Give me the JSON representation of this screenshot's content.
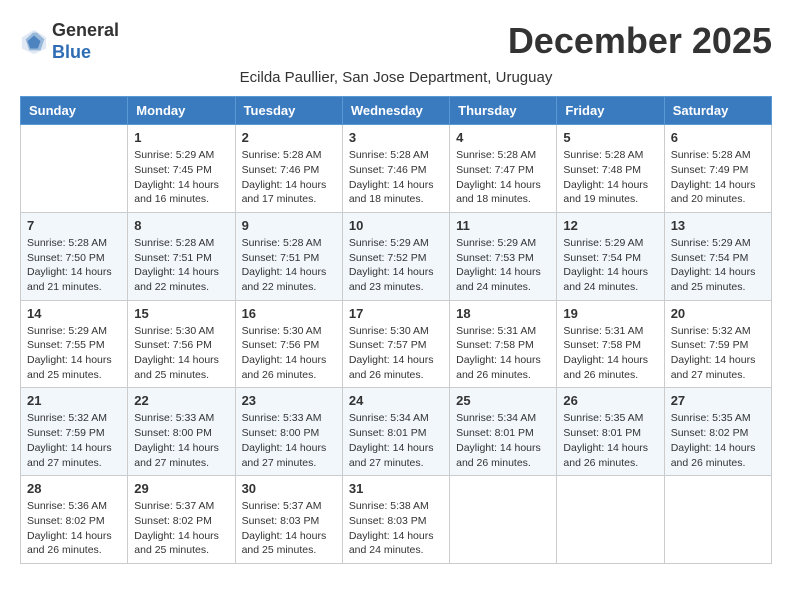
{
  "header": {
    "logo_line1": "General",
    "logo_line2": "Blue",
    "month_title": "December 2025",
    "subtitle": "Ecilda Paullier, San Jose Department, Uruguay"
  },
  "weekdays": [
    "Sunday",
    "Monday",
    "Tuesday",
    "Wednesday",
    "Thursday",
    "Friday",
    "Saturday"
  ],
  "weeks": [
    [
      {
        "day": "",
        "info": ""
      },
      {
        "day": "1",
        "info": "Sunrise: 5:29 AM\nSunset: 7:45 PM\nDaylight: 14 hours\nand 16 minutes."
      },
      {
        "day": "2",
        "info": "Sunrise: 5:28 AM\nSunset: 7:46 PM\nDaylight: 14 hours\nand 17 minutes."
      },
      {
        "day": "3",
        "info": "Sunrise: 5:28 AM\nSunset: 7:46 PM\nDaylight: 14 hours\nand 18 minutes."
      },
      {
        "day": "4",
        "info": "Sunrise: 5:28 AM\nSunset: 7:47 PM\nDaylight: 14 hours\nand 18 minutes."
      },
      {
        "day": "5",
        "info": "Sunrise: 5:28 AM\nSunset: 7:48 PM\nDaylight: 14 hours\nand 19 minutes."
      },
      {
        "day": "6",
        "info": "Sunrise: 5:28 AM\nSunset: 7:49 PM\nDaylight: 14 hours\nand 20 minutes."
      }
    ],
    [
      {
        "day": "7",
        "info": "Sunrise: 5:28 AM\nSunset: 7:50 PM\nDaylight: 14 hours\nand 21 minutes."
      },
      {
        "day": "8",
        "info": "Sunrise: 5:28 AM\nSunset: 7:51 PM\nDaylight: 14 hours\nand 22 minutes."
      },
      {
        "day": "9",
        "info": "Sunrise: 5:28 AM\nSunset: 7:51 PM\nDaylight: 14 hours\nand 22 minutes."
      },
      {
        "day": "10",
        "info": "Sunrise: 5:29 AM\nSunset: 7:52 PM\nDaylight: 14 hours\nand 23 minutes."
      },
      {
        "day": "11",
        "info": "Sunrise: 5:29 AM\nSunset: 7:53 PM\nDaylight: 14 hours\nand 24 minutes."
      },
      {
        "day": "12",
        "info": "Sunrise: 5:29 AM\nSunset: 7:54 PM\nDaylight: 14 hours\nand 24 minutes."
      },
      {
        "day": "13",
        "info": "Sunrise: 5:29 AM\nSunset: 7:54 PM\nDaylight: 14 hours\nand 25 minutes."
      }
    ],
    [
      {
        "day": "14",
        "info": "Sunrise: 5:29 AM\nSunset: 7:55 PM\nDaylight: 14 hours\nand 25 minutes."
      },
      {
        "day": "15",
        "info": "Sunrise: 5:30 AM\nSunset: 7:56 PM\nDaylight: 14 hours\nand 25 minutes."
      },
      {
        "day": "16",
        "info": "Sunrise: 5:30 AM\nSunset: 7:56 PM\nDaylight: 14 hours\nand 26 minutes."
      },
      {
        "day": "17",
        "info": "Sunrise: 5:30 AM\nSunset: 7:57 PM\nDaylight: 14 hours\nand 26 minutes."
      },
      {
        "day": "18",
        "info": "Sunrise: 5:31 AM\nSunset: 7:58 PM\nDaylight: 14 hours\nand 26 minutes."
      },
      {
        "day": "19",
        "info": "Sunrise: 5:31 AM\nSunset: 7:58 PM\nDaylight: 14 hours\nand 26 minutes."
      },
      {
        "day": "20",
        "info": "Sunrise: 5:32 AM\nSunset: 7:59 PM\nDaylight: 14 hours\nand 27 minutes."
      }
    ],
    [
      {
        "day": "21",
        "info": "Sunrise: 5:32 AM\nSunset: 7:59 PM\nDaylight: 14 hours\nand 27 minutes."
      },
      {
        "day": "22",
        "info": "Sunrise: 5:33 AM\nSunset: 8:00 PM\nDaylight: 14 hours\nand 27 minutes."
      },
      {
        "day": "23",
        "info": "Sunrise: 5:33 AM\nSunset: 8:00 PM\nDaylight: 14 hours\nand 27 minutes."
      },
      {
        "day": "24",
        "info": "Sunrise: 5:34 AM\nSunset: 8:01 PM\nDaylight: 14 hours\nand 27 minutes."
      },
      {
        "day": "25",
        "info": "Sunrise: 5:34 AM\nSunset: 8:01 PM\nDaylight: 14 hours\nand 26 minutes."
      },
      {
        "day": "26",
        "info": "Sunrise: 5:35 AM\nSunset: 8:01 PM\nDaylight: 14 hours\nand 26 minutes."
      },
      {
        "day": "27",
        "info": "Sunrise: 5:35 AM\nSunset: 8:02 PM\nDaylight: 14 hours\nand 26 minutes."
      }
    ],
    [
      {
        "day": "28",
        "info": "Sunrise: 5:36 AM\nSunset: 8:02 PM\nDaylight: 14 hours\nand 26 minutes."
      },
      {
        "day": "29",
        "info": "Sunrise: 5:37 AM\nSunset: 8:02 PM\nDaylight: 14 hours\nand 25 minutes."
      },
      {
        "day": "30",
        "info": "Sunrise: 5:37 AM\nSunset: 8:03 PM\nDaylight: 14 hours\nand 25 minutes."
      },
      {
        "day": "31",
        "info": "Sunrise: 5:38 AM\nSunset: 8:03 PM\nDaylight: 14 hours\nand 24 minutes."
      },
      {
        "day": "",
        "info": ""
      },
      {
        "day": "",
        "info": ""
      },
      {
        "day": "",
        "info": ""
      }
    ]
  ]
}
